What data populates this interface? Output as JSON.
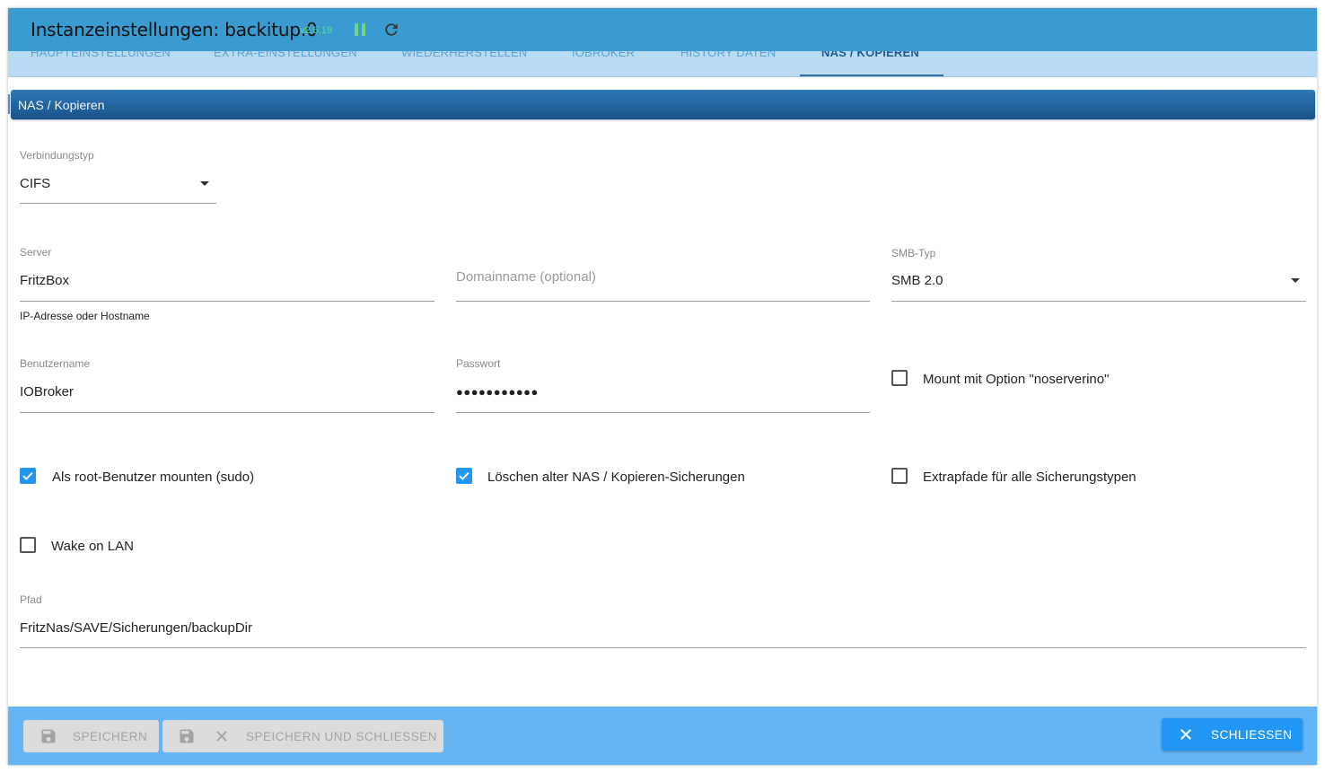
{
  "window": {
    "title": "Instanzeinstellungen: backitup.0",
    "version": "v2.6.19",
    "pause_icon": "pause-icon",
    "reload_icon": "reload-icon"
  },
  "tabs": [
    {
      "label": "Haupteinstellungen",
      "active": false
    },
    {
      "label": "Extra-Einstellungen",
      "active": false
    },
    {
      "label": "Wiederherstellen",
      "active": false
    },
    {
      "label": "ioBroker",
      "active": false
    },
    {
      "label": "History Daten",
      "active": false
    },
    {
      "label": "NAS / Kopieren",
      "active": true
    }
  ],
  "section": {
    "title": "NAS / Kopieren"
  },
  "form": {
    "connection_type": {
      "label": "Verbindungstyp",
      "value": "CIFS"
    },
    "server": {
      "label": "Server",
      "value": "FritzBox",
      "helper": "IP-Adresse oder Hostname"
    },
    "domain": {
      "placeholder": "Domainname (optional)",
      "value": ""
    },
    "smb_type": {
      "label": "SMB-Typ",
      "value": "SMB 2.0"
    },
    "username": {
      "label": "Benutzername",
      "value": "IOBroker"
    },
    "password": {
      "label": "Passwort",
      "value": "●●●●●●●●●●●"
    },
    "noserverino": {
      "label": "Mount mit Option \"noserverino\"",
      "checked": false
    },
    "sudo": {
      "label": "Als root-Benutzer mounten (sudo)",
      "checked": true
    },
    "delete_old": {
      "label": "Löschen alter NAS / Kopieren-Sicherungen",
      "checked": true
    },
    "extra_paths": {
      "label": "Extrapfade für alle Sicherungstypen",
      "checked": false
    },
    "wake_on_lan": {
      "label": "Wake on LAN",
      "checked": false
    },
    "path": {
      "label": "Pfad",
      "value": "FritzNas/SAVE/Sicherungen/backupDir"
    }
  },
  "footer": {
    "save_label": "Speichern",
    "save_close_label": "Speichern und schliessen",
    "close_label": "Schliessen"
  },
  "colors": {
    "title_bar": "#3a9bd0",
    "tabs_bar": "#b9dbf4",
    "section_header": "#1a5288",
    "footer": "#64b5f6",
    "primary": "#2196f3",
    "version": "#52e08c"
  }
}
